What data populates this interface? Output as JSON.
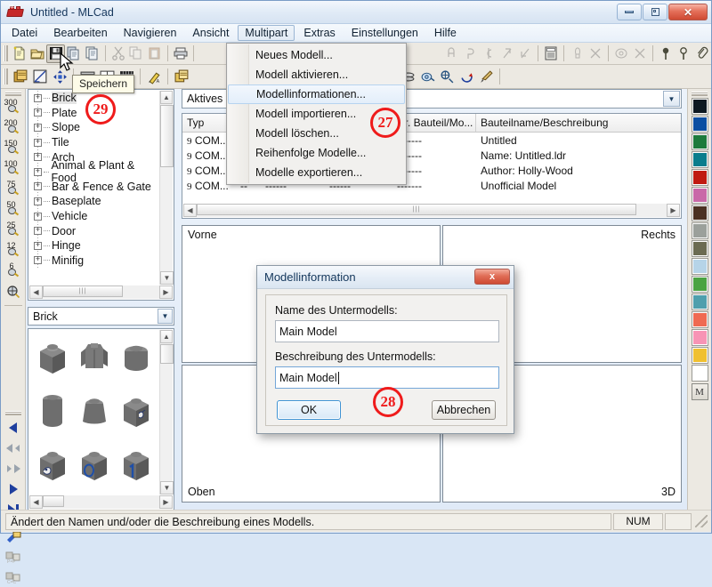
{
  "window": {
    "title": "Untitled - MLCad",
    "logo_icon": "mlcad-brick-logo",
    "controls": [
      {
        "name": "minimize-button",
        "icon": "minimize-icon",
        "label": ""
      },
      {
        "name": "restore-button",
        "icon": "restore-icon",
        "label": ""
      },
      {
        "name": "close-button",
        "icon": "close-icon",
        "label": "x"
      }
    ]
  },
  "menubar": {
    "items": [
      {
        "label": "Datei",
        "open": false
      },
      {
        "label": "Bearbeiten",
        "open": false
      },
      {
        "label": "Navigieren",
        "open": false
      },
      {
        "label": "Ansicht",
        "open": false
      },
      {
        "label": "Multipart",
        "open": true
      },
      {
        "label": "Extras",
        "open": false
      },
      {
        "label": "Einstellungen",
        "open": false
      },
      {
        "label": "Hilfe",
        "open": false
      }
    ]
  },
  "dropdown": {
    "owner": "Multipart",
    "items": [
      {
        "label": "Neues Modell...",
        "highlighted": false
      },
      {
        "label": "Modell aktivieren...",
        "highlighted": false
      },
      {
        "label": "Modellinformationen...",
        "highlighted": true
      },
      {
        "label": "Modell importieren...",
        "highlighted": false
      },
      {
        "label": "Modell löschen...",
        "highlighted": false
      },
      {
        "label": "Reihenfolge Modelle...",
        "highlighted": false
      },
      {
        "label": "Modelle exportieren...",
        "highlighted": false
      }
    ]
  },
  "toolbar_top": {
    "buttons": [
      {
        "name": "new-file-button",
        "icon": "new-document-icon",
        "dim": false,
        "pressed": false
      },
      {
        "name": "open-file-button",
        "icon": "open-folder-icon",
        "dim": false,
        "pressed": false
      },
      {
        "name": "save-file-button",
        "icon": "floppy-disk-icon",
        "dim": false,
        "pressed": true
      },
      {
        "name": "new-model-button",
        "icon": "copy-pages-icon",
        "dim": false,
        "pressed": false
      },
      {
        "name": "model-properties-button",
        "icon": "document-pages-icon",
        "dim": false,
        "pressed": false
      },
      {
        "name": "cut-button",
        "icon": "scissors-icon",
        "dim": true,
        "pressed": false
      },
      {
        "name": "copy-button",
        "icon": "copy-icon",
        "dim": true,
        "pressed": false
      },
      {
        "name": "paste-button",
        "icon": "clipboard-icon",
        "dim": true,
        "pressed": false
      },
      {
        "name": "print-button",
        "icon": "printer-icon",
        "dim": false,
        "pressed": false
      }
    ],
    "tooltip": "Speichern"
  },
  "toolbar_second": {
    "buttons": [
      {
        "name": "select-all-button",
        "icon": "layers-icon"
      },
      {
        "name": "draw-mode-button",
        "icon": "pencil-ruler-icon"
      },
      {
        "name": "move-button",
        "icon": "move-arrows-icon"
      },
      {
        "name": "single-view-button",
        "icon": "single-pane-icon"
      },
      {
        "name": "split-view-button",
        "icon": "split-pane-icon"
      },
      {
        "name": "grid-button",
        "icon": "grid-icon"
      },
      {
        "name": "color-picker-button",
        "icon": "highlighter-icon"
      },
      {
        "name": "multipart-button",
        "icon": "multipart-icon"
      },
      {
        "name": "rotate-step-button",
        "icon": "rotate-step-icon"
      },
      {
        "name": "add-part-button",
        "icon": "add-part-icon"
      },
      {
        "name": "minifig-button",
        "icon": "minifig-head-icon"
      },
      {
        "name": "group-button",
        "icon": "group-icon"
      },
      {
        "name": "light-button",
        "icon": "light-bulb-icon"
      },
      {
        "name": "camera-button",
        "icon": "camera-icon"
      },
      {
        "name": "rotate-view-button",
        "icon": "rotate-view-icon"
      },
      {
        "name": "paint-button",
        "icon": "paint-brush-icon"
      }
    ]
  },
  "zoom_toolbar": {
    "name": "zoom-levels-toolbar",
    "levels": [
      "300",
      "200",
      "150",
      "100",
      "75",
      "50",
      "25",
      "12",
      "6"
    ],
    "fit_icon": "zoom-fit-icon"
  },
  "nav_toolbar": {
    "buttons": [
      {
        "name": "step-first-button",
        "icon": "triangle-left-icon",
        "dim": false
      },
      {
        "name": "step-prev-fast-button",
        "icon": "double-arrow-left-icon",
        "dim": true
      },
      {
        "name": "step-next-fast-button",
        "icon": "double-arrow-right-icon",
        "dim": true
      },
      {
        "name": "step-play-button",
        "icon": "triangle-right-icon",
        "dim": false
      },
      {
        "name": "step-last-button",
        "icon": "skip-right-icon",
        "dim": false
      },
      {
        "name": "pipette-button",
        "icon": "pipette-icon",
        "dim": false
      },
      {
        "name": "part-to-part-button",
        "icon": "part-to-part-icon",
        "dim": true
      },
      {
        "name": "color-to-color-button",
        "icon": "color-to-color-icon",
        "dim": true
      }
    ]
  },
  "parts_tree": {
    "name": "parts-category-tree",
    "items": [
      {
        "label": "Brick",
        "selected": true
      },
      {
        "label": "Plate",
        "selected": false
      },
      {
        "label": "Slope",
        "selected": false
      },
      {
        "label": "Tile",
        "selected": false
      },
      {
        "label": "Arch",
        "selected": false
      },
      {
        "label": "Animal & Plant & Food",
        "selected": false
      },
      {
        "label": "Bar & Fence & Gate",
        "selected": false
      },
      {
        "label": "Baseplate",
        "selected": false
      },
      {
        "label": "Vehicle",
        "selected": false
      },
      {
        "label": "Door",
        "selected": false
      },
      {
        "label": "Hinge",
        "selected": false
      },
      {
        "label": "Minifig",
        "selected": false
      }
    ],
    "expander_symbol": "+"
  },
  "parts_preview": {
    "category_selected": "Brick",
    "thumbnails": [
      {
        "name": "part-thumb-brick-1x1"
      },
      {
        "name": "part-thumb-minifig-torso"
      },
      {
        "name": "part-thumb-brick-round-1x1"
      },
      {
        "name": "part-thumb-brick-round-tall"
      },
      {
        "name": "part-thumb-brick-cone"
      },
      {
        "name": "part-thumb-brick-pattern-bird"
      },
      {
        "name": "part-thumb-brick-pattern-swan"
      },
      {
        "name": "part-thumb-brick-pattern-o"
      },
      {
        "name": "part-thumb-brick-pattern-1"
      }
    ]
  },
  "model_combo": {
    "name": "active-model-combo",
    "value": "Aktives Modell: Main Model"
  },
  "model_grid": {
    "columns": [
      "Typ",
      "",
      "",
      "",
      "Nr. Bauteil/Mo...",
      "Bauteilname/Beschreibung"
    ],
    "rows": [
      {
        "type": "COM...",
        "c2": "--",
        "c3": "------",
        "c4": "------",
        "c5": "-------",
        "desc": "Untitled"
      },
      {
        "type": "COM...",
        "c2": "--",
        "c3": "------",
        "c4": "------",
        "c5": "-------",
        "desc": "Name: Untitled.ldr"
      },
      {
        "type": "COM...",
        "c2": "--",
        "c3": "------",
        "c4": "------",
        "c5": "-------",
        "desc": "Author: Holly-Wood"
      },
      {
        "type": "COM...",
        "c2": "--",
        "c3": "------",
        "c4": "------",
        "c5": "-------",
        "desc": "Unofficial Model"
      }
    ],
    "row_marker": "9"
  },
  "viewports": [
    {
      "name": "viewport-front",
      "label": "Vorne",
      "align": "left"
    },
    {
      "name": "viewport-right",
      "label": "Rechts",
      "align": "right"
    },
    {
      "name": "viewport-top",
      "label": "Oben",
      "align": "left"
    },
    {
      "name": "viewport-3d",
      "label": "3D",
      "align": "right"
    }
  ],
  "color_palette": {
    "name": "color-palette",
    "colors": [
      "#0d1821",
      "#0b4ea2",
      "#1d7a3c",
      "#0a7d8c",
      "#c01a10",
      "#c969a8",
      "#4b3122",
      "#9ba09b",
      "#6b6b52",
      "#b6d4e8",
      "#4ba342",
      "#4f9fad",
      "#ef6a52",
      "#f794b5",
      "#f0c030",
      "#ffffff"
    ],
    "more_button_label": "M"
  },
  "statusbar": {
    "message": "Ändert den Namen und/oder die Beschreibung eines Modells.",
    "cell_num": "NUM",
    "cell_extra": "",
    "grip_icon": "resize-grip-icon"
  },
  "dialog": {
    "title": "Modellinformation",
    "close_label": "x",
    "name_label": "Name des Untermodells:",
    "name_value": "Main Model",
    "description_label": "Beschreibung des Untermodells:",
    "description_value": "Main Model",
    "ok_label": "OK",
    "cancel_label": "Abbrechen"
  },
  "annotations": [
    {
      "name": "annotation-badge-27",
      "label": "27"
    },
    {
      "name": "annotation-badge-28",
      "label": "28"
    },
    {
      "name": "annotation-badge-29",
      "label": "29"
    }
  ]
}
